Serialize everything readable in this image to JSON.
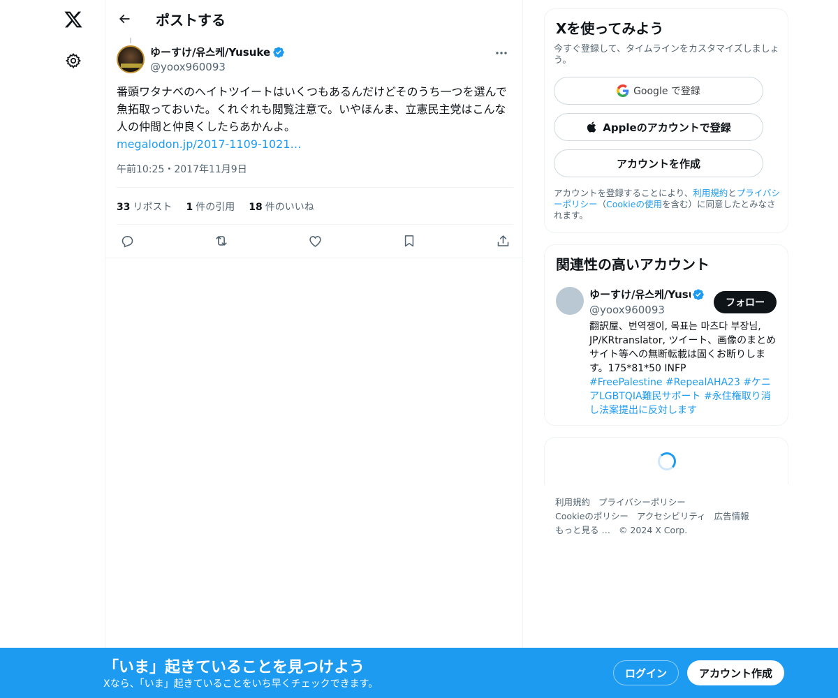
{
  "nav": {
    "logo_icon": "x-logo-icon",
    "settings_icon": "gear-icon"
  },
  "header": {
    "title": "ポストする",
    "back_icon": "arrow-left-icon"
  },
  "tweet": {
    "author_name": "ゆーすけ/유스케/Yusuke",
    "author_handle": "@yoox960093",
    "verified": true,
    "text": "番頭ワタナベのヘイトツイートはいくつもあるんだけどそのうち一つを選んで魚拓取っておいた。くれぐれも閲覧注意で。いやほんま、立憲民主党はこんな人の仲間と仲良くしたらあかんよ。",
    "link": "megalodon.jp/2017-1109-1021…",
    "timestamp": "午前10:25・2017年11月9日",
    "stats": {
      "reposts_count": "33",
      "reposts_label": "リポスト",
      "quotes_count": "1",
      "quotes_label": "件の引用",
      "likes_count": "18",
      "likes_label": "件のいいね"
    },
    "actions": [
      "reply-icon",
      "repost-icon",
      "like-icon",
      "bookmark-icon",
      "share-icon"
    ]
  },
  "signup_card": {
    "title": "Xを使ってみよう",
    "subtitle": "今すぐ登録して、タイムラインをカスタマイズしましょう。",
    "google_label": "Google で登録",
    "apple_label": "Appleのアカウントで登録",
    "create_label": "アカウントを作成",
    "legal_prefix": "アカウントを登録することにより、",
    "legal_terms": "利用規約",
    "legal_and": "と",
    "legal_privacy": "プライバシーポリシー",
    "legal_paren_open": "（",
    "legal_cookie": "Cookieの使用",
    "legal_suffix": "を含む）に同意したとみなされます。"
  },
  "related_card": {
    "title": "関連性の高いアカウント",
    "name": "ゆーすけ/유스케/Yusuke",
    "handle": "@yoox960093",
    "follow_label": "フォロー",
    "bio": "翻訳屋、번역쟁이, 목표는 마츠다 부장님, JP/KRtranslator, ツイート、画像のまとめサイト等への無断転載は固くお断りします。175*81*50 INFP",
    "hashtags": [
      "#FreePalestine",
      "#RepealAHA23",
      "#ケニアLGBTQIA難民サポート",
      "#永住権取り消し法案提出に反対します"
    ]
  },
  "footer": {
    "links": [
      "利用規約",
      "プライバシーポリシー",
      "Cookieのポリシー",
      "アクセシビリティ",
      "広告情報",
      "もっと見る …"
    ],
    "copyright": "© 2024 X Corp."
  },
  "banner": {
    "title": "「いま」起きていることを見つけよう",
    "subtitle": "Xなら、「いま」起きていることをいち早くチェックできます。",
    "login_label": "ログイン",
    "signup_label": "アカウント作成"
  },
  "colors": {
    "accent": "#1d9bf0",
    "text": "#0f1419",
    "secondary": "#536471",
    "border": "#eff3f4"
  }
}
